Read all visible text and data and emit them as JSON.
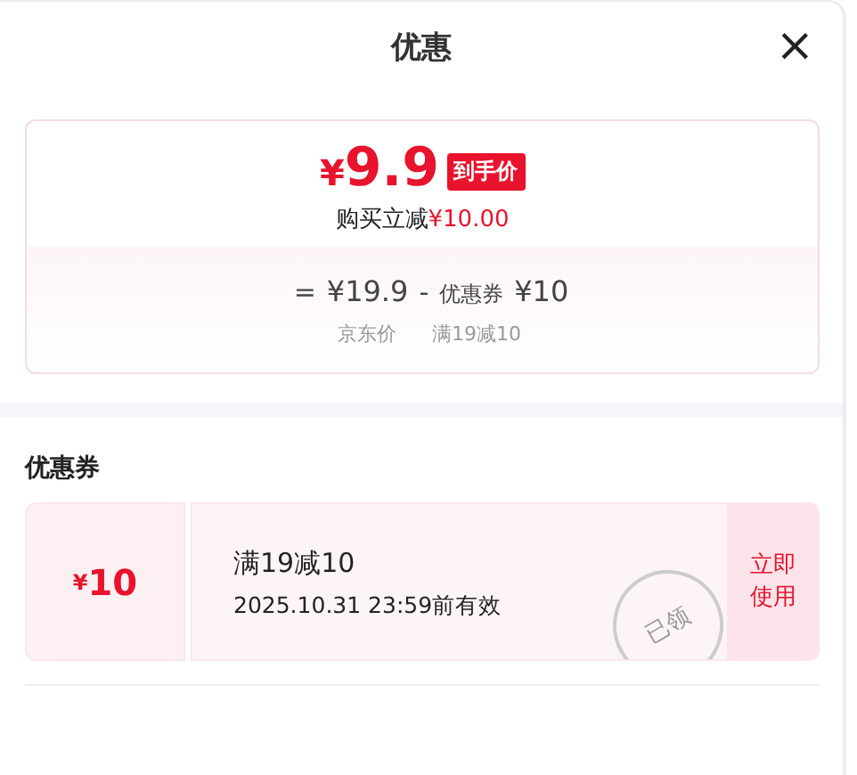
{
  "title": "优惠",
  "close": "×",
  "summary": {
    "currency": "¥",
    "price": "9.9",
    "badge": "到手价",
    "saving_label": "购买立减",
    "saving": "¥10.00",
    "formula": {
      "equals": "=",
      "base": "¥19.9",
      "minus": "-",
      "coupon_label": "优惠券",
      "coupon": "¥10",
      "base_caption": "京东价",
      "coupon_caption": "满19减10"
    }
  },
  "coupons_heading": "优惠券",
  "coupons": [
    {
      "currency": "¥",
      "amount": "10",
      "condition": "满19减10",
      "validity": "2025.10.31 23:59前有效",
      "stamp": "已领",
      "action": "立即使用"
    }
  ]
}
